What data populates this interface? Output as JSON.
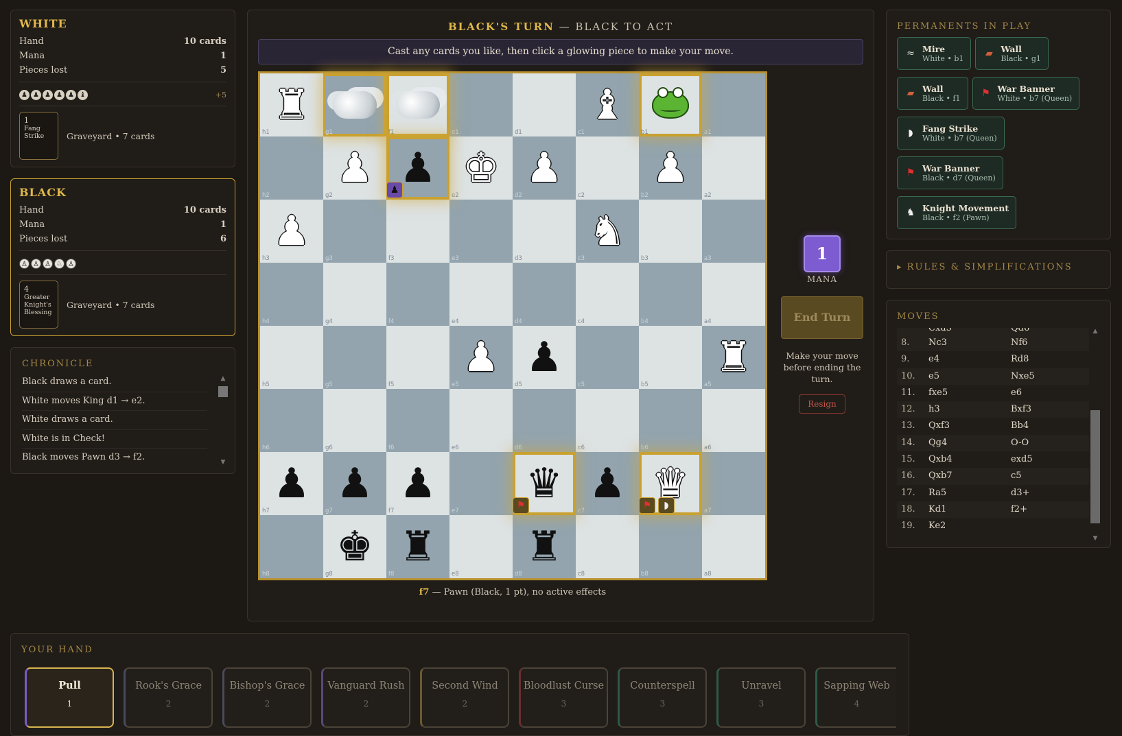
{
  "white": {
    "name": "WHITE",
    "hand_label": "Hand",
    "hand": "10 cards",
    "mana_label": "Mana",
    "mana": "1",
    "lost_label": "Pieces lost",
    "lost": "5",
    "captured_points": "+5",
    "top_card_cost": "1",
    "top_card_name": "Fang Strike",
    "graveyard": "Graveyard • 7 cards"
  },
  "black": {
    "name": "BLACK",
    "hand_label": "Hand",
    "hand": "10 cards",
    "mana_label": "Mana",
    "mana": "1",
    "lost_label": "Pieces lost",
    "lost": "6",
    "top_card_cost": "4",
    "top_card_name": "Greater Knight's Blessing",
    "graveyard": "Graveyard • 7 cards"
  },
  "chronicle": {
    "title": "CHRONICLE",
    "entries": [
      "Black draws a card.",
      "White moves King d1 → e2.",
      "White draws a card.",
      "White is in Check!",
      "Black moves Pawn d3 → f2."
    ]
  },
  "turn": {
    "title": "BLACK'S TURN",
    "subtitle": "— BLACK TO ACT",
    "instruction": "Cast any cards you like, then click a glowing piece to make your move."
  },
  "status": {
    "square": "f7",
    "text": " — Pawn (Black, 1 pt), no active effects"
  },
  "mana": {
    "value": "1",
    "label": "MANA"
  },
  "controls": {
    "end_turn": "End Turn",
    "hint": "Make your move before ending the turn.",
    "resign": "Resign"
  },
  "permanents": {
    "title": "PERMANENTS IN PLAY",
    "items": [
      {
        "name": "Mire",
        "sub": "White • b1",
        "icon": "mire-icon"
      },
      {
        "name": "Wall",
        "sub": "Black • g1",
        "icon": "brick-icon"
      },
      {
        "name": "Wall",
        "sub": "Black • f1",
        "icon": "brick-icon"
      },
      {
        "name": "War Banner",
        "sub": "White • b7 (Queen)",
        "icon": "flag-icon"
      },
      {
        "name": "Fang Strike",
        "sub": "White • b7 (Queen)",
        "icon": "tooth-icon"
      },
      {
        "name": "War Banner",
        "sub": "Black • d7 (Queen)",
        "icon": "flag-icon"
      },
      {
        "name": "Knight Movement",
        "sub": "Black • f2 (Pawn)",
        "icon": "knight-icon"
      }
    ]
  },
  "rules": {
    "title": "▸ RULES & SIMPLIFICATIONS"
  },
  "moves": {
    "title": "MOVES",
    "list": [
      {
        "n": "8.",
        "w": "Nc3",
        "b": "Nf6"
      },
      {
        "n": "9.",
        "w": "e4",
        "b": "Rd8"
      },
      {
        "n": "10.",
        "w": "e5",
        "b": "Nxe5"
      },
      {
        "n": "11.",
        "w": "fxe5",
        "b": "e6"
      },
      {
        "n": "12.",
        "w": "h3",
        "b": "Bxf3"
      },
      {
        "n": "13.",
        "w": "Qxf3",
        "b": "Bb4"
      },
      {
        "n": "14.",
        "w": "Qg4",
        "b": "O-O"
      },
      {
        "n": "15.",
        "w": "Qxb4",
        "b": "exd5"
      },
      {
        "n": "16.",
        "w": "Qxb7",
        "b": "c5"
      },
      {
        "n": "17.",
        "w": "Ra5",
        "b": "d3+"
      },
      {
        "n": "18.",
        "w": "Kd1",
        "b": "f2+"
      },
      {
        "n": "19.",
        "w": "Ke2",
        "b": ""
      }
    ]
  },
  "hand": {
    "title": "YOUR HAND",
    "cards": [
      {
        "name": "Pull",
        "cost": "1",
        "color": "#7a5ac8"
      },
      {
        "name": "Rook's Grace",
        "cost": "2",
        "color": "#4a4a5e"
      },
      {
        "name": "Bishop's Grace",
        "cost": "2",
        "color": "#4a4a5e"
      },
      {
        "name": "Vanguard Rush",
        "cost": "2",
        "color": "#5a4a78"
      },
      {
        "name": "Second Wind",
        "cost": "2",
        "color": "#6a5a30"
      },
      {
        "name": "Bloodlust Curse",
        "cost": "3",
        "color": "#6a2e2e"
      },
      {
        "name": "Counterspell",
        "cost": "3",
        "color": "#2e5a48"
      },
      {
        "name": "Unravel",
        "cost": "3",
        "color": "#2e5a48"
      },
      {
        "name": "Sapping Web",
        "cost": "4",
        "color": "#2e5a48"
      }
    ]
  },
  "board": {
    "files": [
      "h",
      "g",
      "f",
      "e",
      "d",
      "c",
      "b",
      "a"
    ],
    "ranks": [
      "1",
      "2",
      "3",
      "4",
      "5",
      "6",
      "7",
      "8"
    ],
    "pieces": [
      [
        "wR",
        "cloud",
        "cloud",
        "",
        "",
        "wB",
        "frog",
        ""
      ],
      [
        "",
        "wP",
        "bP",
        "wK",
        "wP",
        "",
        "wP",
        ""
      ],
      [
        "wP",
        "",
        "",
        "",
        "",
        "wN",
        "",
        ""
      ],
      [
        "",
        "",
        "",
        "",
        "",
        "",
        "",
        ""
      ],
      [
        "",
        "",
        "",
        "wP",
        "bP",
        "",
        "",
        "wR"
      ],
      [
        "",
        "",
        "",
        "",
        "",
        "",
        "",
        ""
      ],
      [
        "bP",
        "bP",
        "bP",
        "",
        "bQ",
        "bP",
        "wQ",
        ""
      ],
      [
        "",
        "bK",
        "bR",
        "",
        "bR",
        "",
        "",
        ""
      ]
    ],
    "highlights": [
      "g1",
      "f1",
      "b1",
      "f2",
      "d7",
      "b7"
    ]
  }
}
